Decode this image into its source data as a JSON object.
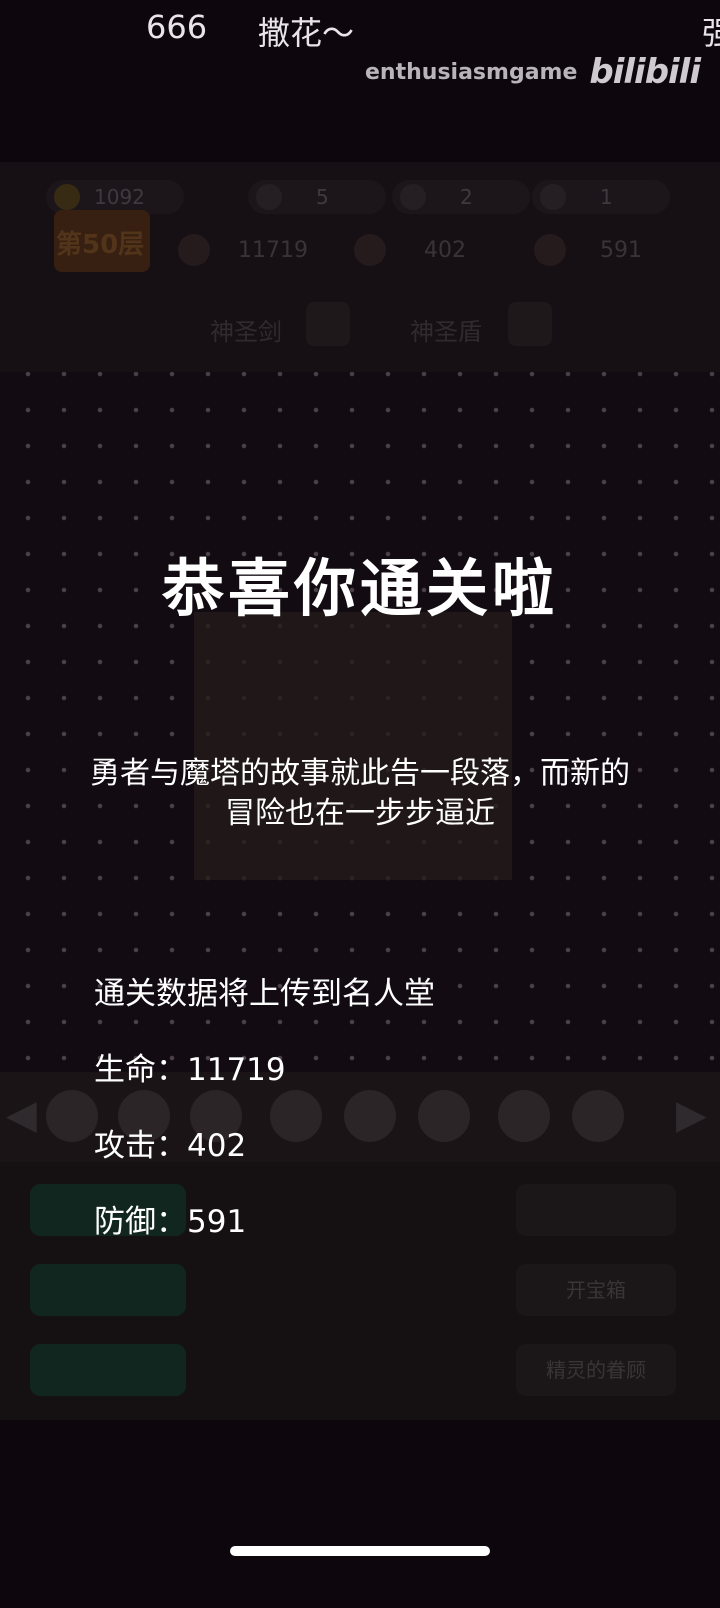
{
  "danmaku": [
    "666",
    "撒花～",
    "强"
  ],
  "watermark": {
    "user": "enthusiasmgame",
    "logo": "bilibili"
  },
  "hud": {
    "resources": [
      "1092",
      "5",
      "2",
      "1"
    ],
    "floor": "第50层",
    "stats": [
      "11719",
      "402",
      "591"
    ],
    "equipment": [
      "神圣剑",
      "神圣盾"
    ]
  },
  "menu": {
    "right_buttons": [
      "",
      "开宝箱",
      "精灵的眷顾"
    ]
  },
  "overlay": {
    "title": "恭喜你通关啦",
    "story": "勇者与魔塔的故事就此告一段落，而新的冒险也在一步步逼近",
    "upload_note": "通关数据将上传到名人堂",
    "hp": "生命：11719",
    "atk": "攻击：402",
    "def": "防御：591"
  },
  "colors": {
    "background": "#0d070d",
    "text": "#ffffff"
  }
}
